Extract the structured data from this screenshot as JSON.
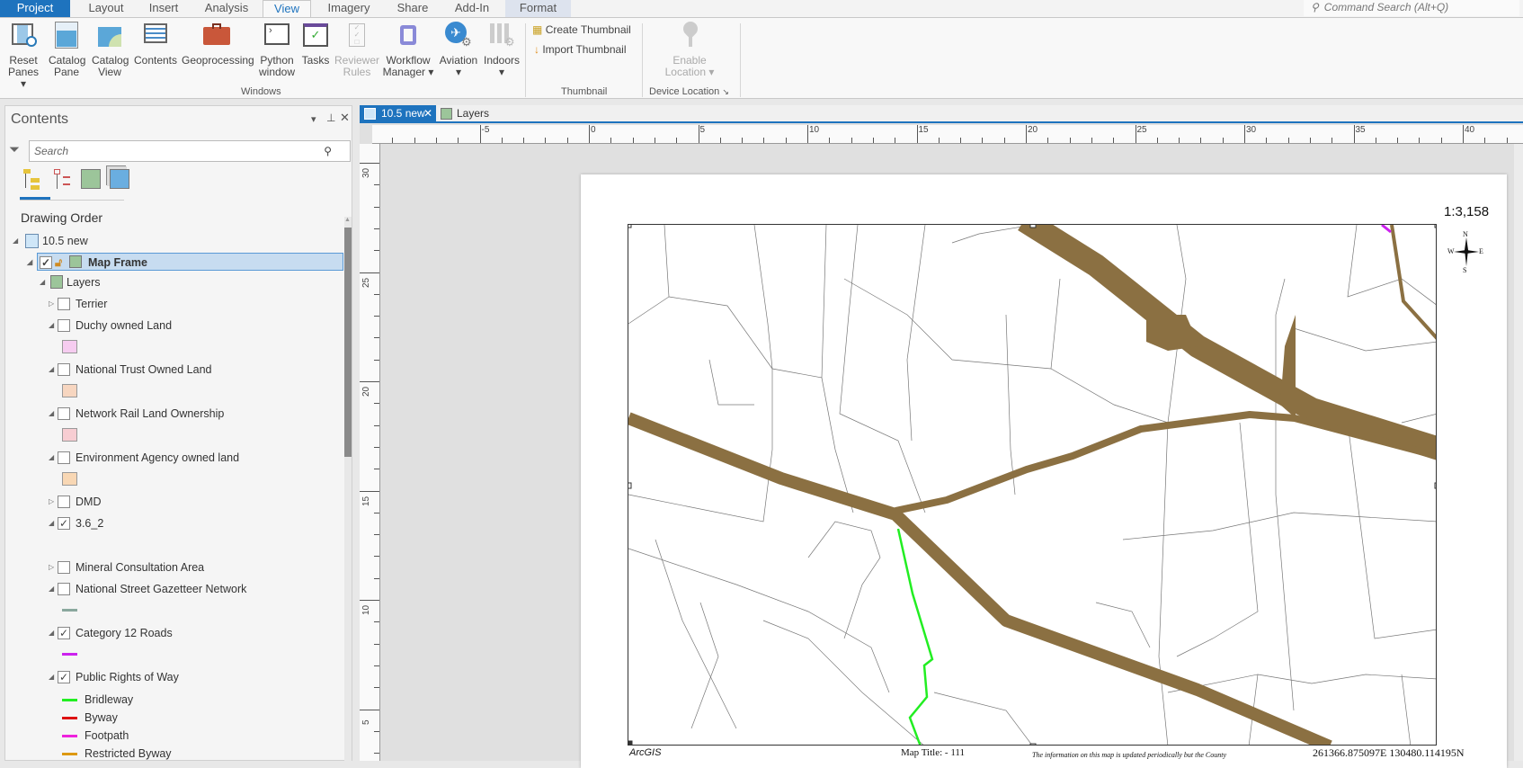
{
  "main_tabs": [
    "Project",
    "Layout",
    "Insert",
    "Analysis",
    "View",
    "Imagery",
    "Share",
    "Add-In",
    "Format"
  ],
  "command_search": "Command Search (Alt+Q)",
  "ribbon": {
    "windows_buttons": [
      {
        "l1": "Reset",
        "l2": "Panes ▾"
      },
      {
        "l1": "Catalog",
        "l2": "Pane"
      },
      {
        "l1": "Catalog",
        "l2": "View"
      },
      {
        "l1": "Contents",
        "l2": ""
      },
      {
        "l1": "Geoprocessing",
        "l2": ""
      },
      {
        "l1": "Python",
        "l2": "window"
      },
      {
        "l1": "Tasks",
        "l2": ""
      },
      {
        "l1": "Reviewer",
        "l2": "Rules"
      },
      {
        "l1": "Workflow",
        "l2": "Manager ▾"
      },
      {
        "l1": "Aviation",
        "l2": "▾"
      },
      {
        "l1": "Indoors",
        "l2": "▾"
      }
    ],
    "windows_group": "Windows",
    "create_thumbnail": "Create Thumbnail",
    "import_thumbnail": "Import Thumbnail",
    "thumbnail_group": "Thumbnail",
    "enable_location_1": "Enable",
    "enable_location_2": "Location ▾",
    "device_location_group": "Device Location"
  },
  "contents": {
    "title": "Contents",
    "search_placeholder": "Search",
    "drawing_order": "Drawing Order",
    "map_name": "10.5 new",
    "map_frame": "Map Frame",
    "layers": "Layers",
    "items": [
      {
        "label": "Terrier",
        "checked": false
      },
      {
        "label": "Duchy owned Land",
        "checked": false,
        "swatch": "#f6ccf0"
      },
      {
        "label": "National Trust Owned Land",
        "checked": false,
        "swatch": "#f7d6c0"
      },
      {
        "label": "Network Rail Land Ownership",
        "checked": false,
        "swatch": "#f7cdd2"
      },
      {
        "label": "Environment Agency owned land",
        "checked": false,
        "swatch": "#f8d7b4"
      },
      {
        "label": "DMD",
        "checked": false
      },
      {
        "label": "3.6_2",
        "checked": true
      },
      {
        "label": "Mineral Consultation Area",
        "checked": false
      },
      {
        "label": "National Street Gazetteer Network",
        "checked": false,
        "line": "#8aa89e"
      },
      {
        "label": "Category 12 Roads",
        "checked": true,
        "line": "#cc22ee"
      },
      {
        "label": "Public Rights of Way",
        "checked": true
      }
    ],
    "prow_legend": [
      {
        "label": "Bridleway",
        "color": "#22ee22"
      },
      {
        "label": "Byway",
        "color": "#dd1111"
      },
      {
        "label": "Footpath",
        "color": "#ee22dd"
      },
      {
        "label": "Restricted Byway",
        "color": "#dd9911"
      }
    ]
  },
  "view_tabs": [
    {
      "label": "10.5 new",
      "close": "✕"
    },
    {
      "label": "Layers"
    }
  ],
  "ruler_h": [
    "-5",
    "0",
    "5",
    "10",
    "15",
    "20",
    "25",
    "30",
    "35",
    "40"
  ],
  "ruler_v": [
    "30",
    "25",
    "20",
    "15",
    "10",
    "5"
  ],
  "layout": {
    "scale": "1:3,158",
    "north": {
      "n": "N",
      "s": "S",
      "e": "E",
      "w": "W"
    },
    "arcgis": "ArcGIS",
    "map_title": "Map Title: - 111",
    "info_text": "The information on this map is updated periodically but the County",
    "coordinates": "261366.875097E 130480.114195N"
  },
  "colors": {
    "accent": "#1e73be",
    "road": "#8b7042",
    "bridleway": "#22ee22",
    "selection": "#c7dcf0"
  }
}
